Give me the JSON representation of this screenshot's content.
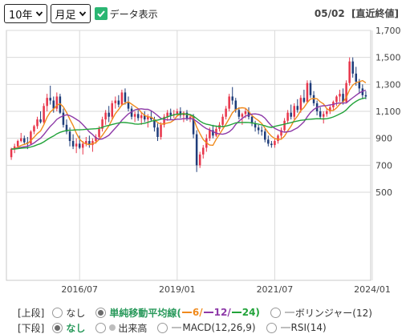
{
  "controls": {
    "period": "10年",
    "interval": "月足",
    "data_table_label": "データ表示",
    "data_table_checked": true,
    "date_label": "05/02  [直近終値]"
  },
  "upper": {
    "segment_label": "[上段]",
    "options": [
      {
        "label": "なし",
        "selected": false
      },
      {
        "label": "単純移動平均線(",
        "selected": true
      },
      {
        "label": "ボリンジャー(12)",
        "selected": false
      }
    ],
    "ma": [
      {
        "label": "6/",
        "color": "#f08a1c"
      },
      {
        "label": "12/",
        "color": "#8e3aa8"
      },
      {
        "label": "24)",
        "color": "#22a33a"
      }
    ]
  },
  "lower": {
    "segment_label": "[下段]",
    "options": [
      {
        "label": "なし",
        "selected": true
      },
      {
        "label": "出来高",
        "selected": false
      },
      {
        "label": "MACD(12,26,9)",
        "selected": false
      },
      {
        "label": "RSI(14)",
        "selected": false
      }
    ]
  },
  "colors": {
    "up": "#e8364b",
    "down": "#1f3d7a",
    "ma6": "#f08a1c",
    "ma12": "#8e3aa8",
    "ma24": "#22a33a",
    "grid": "#d9d9d9",
    "check": "#2bb673"
  },
  "chart_data": {
    "type": "candlestick",
    "interval": "monthly",
    "period": "10 years",
    "y_ticks": [
      500,
      700,
      900,
      1100,
      1300,
      1500,
      1700
    ],
    "y_tick_labels": [
      "500",
      "700",
      "900",
      "1,100",
      "1,300",
      "1,500",
      "1,700"
    ],
    "ylim": [
      500,
      1700
    ],
    "x_tick_labels": [
      "2016/07",
      "2019/01",
      "2021/07",
      "2024/01"
    ],
    "x_tick_index": [
      21,
      51,
      81,
      111
    ],
    "grid": true,
    "series": [
      {
        "name": "6",
        "type": "sma",
        "period": 6
      },
      {
        "name": "12",
        "type": "sma",
        "period": 12
      },
      {
        "name": "24",
        "type": "sma",
        "period": 24
      }
    ],
    "candles": [
      [
        760,
        830,
        740,
        820
      ],
      [
        820,
        860,
        790,
        840
      ],
      [
        840,
        890,
        830,
        880
      ],
      [
        880,
        940,
        870,
        900
      ],
      [
        900,
        920,
        850,
        870
      ],
      [
        870,
        910,
        820,
        860
      ],
      [
        860,
        960,
        850,
        950
      ],
      [
        950,
        1000,
        930,
        990
      ],
      [
        990,
        1060,
        970,
        1040
      ],
      [
        1040,
        1100,
        1010,
        1020
      ],
      [
        1020,
        1160,
        1010,
        1140
      ],
      [
        1140,
        1230,
        1100,
        1200
      ],
      [
        1200,
        1290,
        1150,
        1180
      ],
      [
        1180,
        1210,
        1090,
        1120
      ],
      [
        1120,
        1240,
        1100,
        1210
      ],
      [
        1210,
        1230,
        1080,
        1090
      ],
      [
        1090,
        1120,
        980,
        1000
      ],
      [
        1000,
        1040,
        930,
        950
      ],
      [
        950,
        980,
        840,
        880
      ],
      [
        880,
        930,
        820,
        840
      ],
      [
        840,
        900,
        790,
        860
      ],
      [
        860,
        920,
        820,
        830
      ],
      [
        830,
        880,
        780,
        860
      ],
      [
        860,
        910,
        840,
        880
      ],
      [
        880,
        920,
        830,
        850
      ],
      [
        850,
        900,
        800,
        880
      ],
      [
        880,
        930,
        860,
        910
      ],
      [
        910,
        990,
        900,
        970
      ],
      [
        970,
        1060,
        950,
        1040
      ],
      [
        1040,
        1110,
        1000,
        1090
      ],
      [
        1090,
        1140,
        1020,
        1060
      ],
      [
        1060,
        1180,
        1040,
        1160
      ],
      [
        1160,
        1210,
        1120,
        1180
      ],
      [
        1180,
        1220,
        1130,
        1150
      ],
      [
        1150,
        1260,
        1140,
        1240
      ],
      [
        1240,
        1270,
        1150,
        1170
      ],
      [
        1170,
        1210,
        1100,
        1120
      ],
      [
        1120,
        1140,
        1040,
        1060
      ],
      [
        1060,
        1100,
        1020,
        1080
      ],
      [
        1080,
        1110,
        1030,
        1050
      ],
      [
        1050,
        1090,
        1000,
        1070
      ],
      [
        1070,
        1100,
        1020,
        1040
      ],
      [
        1040,
        1080,
        980,
        1060
      ],
      [
        1060,
        1100,
        1030,
        1040
      ],
      [
        1040,
        1060,
        950,
        980
      ],
      [
        980,
        1010,
        880,
        910
      ],
      [
        910,
        1020,
        890,
        1000
      ],
      [
        1000,
        1080,
        980,
        1060
      ],
      [
        1060,
        1110,
        1030,
        1090
      ],
      [
        1090,
        1120,
        1040,
        1070
      ],
      [
        1070,
        1110,
        1050,
        1080
      ],
      [
        1080,
        1120,
        1060,
        1100
      ],
      [
        1100,
        1130,
        1050,
        1070
      ],
      [
        1070,
        1100,
        1020,
        1090
      ],
      [
        1090,
        1110,
        1030,
        1050
      ],
      [
        1050,
        1080,
        1020,
        1060
      ],
      [
        1060,
        1080,
        900,
        930
      ],
      [
        930,
        960,
        650,
        700
      ],
      [
        700,
        800,
        680,
        780
      ],
      [
        780,
        850,
        750,
        830
      ],
      [
        830,
        930,
        800,
        900
      ],
      [
        900,
        980,
        880,
        960
      ],
      [
        960,
        1000,
        900,
        920
      ],
      [
        920,
        990,
        910,
        970
      ],
      [
        970,
        1020,
        950,
        1000
      ],
      [
        1000,
        1080,
        980,
        1060
      ],
      [
        1060,
        1140,
        1040,
        1120
      ],
      [
        1120,
        1230,
        1100,
        1210
      ],
      [
        1210,
        1280,
        1150,
        1180
      ],
      [
        1180,
        1200,
        1090,
        1110
      ],
      [
        1110,
        1130,
        1040,
        1060
      ],
      [
        1060,
        1090,
        1000,
        1080
      ],
      [
        1080,
        1120,
        1050,
        1100
      ],
      [
        1100,
        1130,
        1040,
        1060
      ],
      [
        1060,
        1080,
        990,
        1010
      ],
      [
        1010,
        1030,
        950,
        980
      ],
      [
        980,
        1000,
        930,
        960
      ],
      [
        960,
        990,
        920,
        950
      ],
      [
        950,
        970,
        870,
        890
      ],
      [
        890,
        920,
        840,
        860
      ],
      [
        860,
        880,
        830,
        850
      ],
      [
        850,
        900,
        830,
        880
      ],
      [
        880,
        930,
        860,
        920
      ],
      [
        920,
        980,
        900,
        960
      ],
      [
        960,
        1050,
        950,
        1030
      ],
      [
        1030,
        1110,
        1010,
        1090
      ],
      [
        1090,
        1150,
        1040,
        1060
      ],
      [
        1060,
        1160,
        1040,
        1140
      ],
      [
        1140,
        1190,
        1090,
        1110
      ],
      [
        1110,
        1220,
        1090,
        1200
      ],
      [
        1200,
        1260,
        1160,
        1170
      ],
      [
        1170,
        1330,
        1160,
        1310
      ],
      [
        1310,
        1330,
        1200,
        1220
      ],
      [
        1220,
        1250,
        1140,
        1160
      ],
      [
        1160,
        1180,
        1070,
        1100
      ],
      [
        1100,
        1130,
        1040,
        1060
      ],
      [
        1060,
        1100,
        1010,
        1080
      ],
      [
        1080,
        1120,
        1060,
        1100
      ],
      [
        1100,
        1150,
        1080,
        1130
      ],
      [
        1130,
        1180,
        1110,
        1170
      ],
      [
        1170,
        1220,
        1140,
        1210
      ],
      [
        1210,
        1260,
        1170,
        1230
      ],
      [
        1230,
        1270,
        1150,
        1170
      ],
      [
        1170,
        1330,
        1160,
        1310
      ],
      [
        1310,
        1500,
        1290,
        1470
      ],
      [
        1470,
        1500,
        1350,
        1380
      ],
      [
        1380,
        1430,
        1290,
        1320
      ],
      [
        1320,
        1340,
        1230,
        1270
      ],
      [
        1270,
        1300,
        1190,
        1220
      ],
      [
        1220,
        1250,
        1190,
        1210
      ]
    ]
  }
}
